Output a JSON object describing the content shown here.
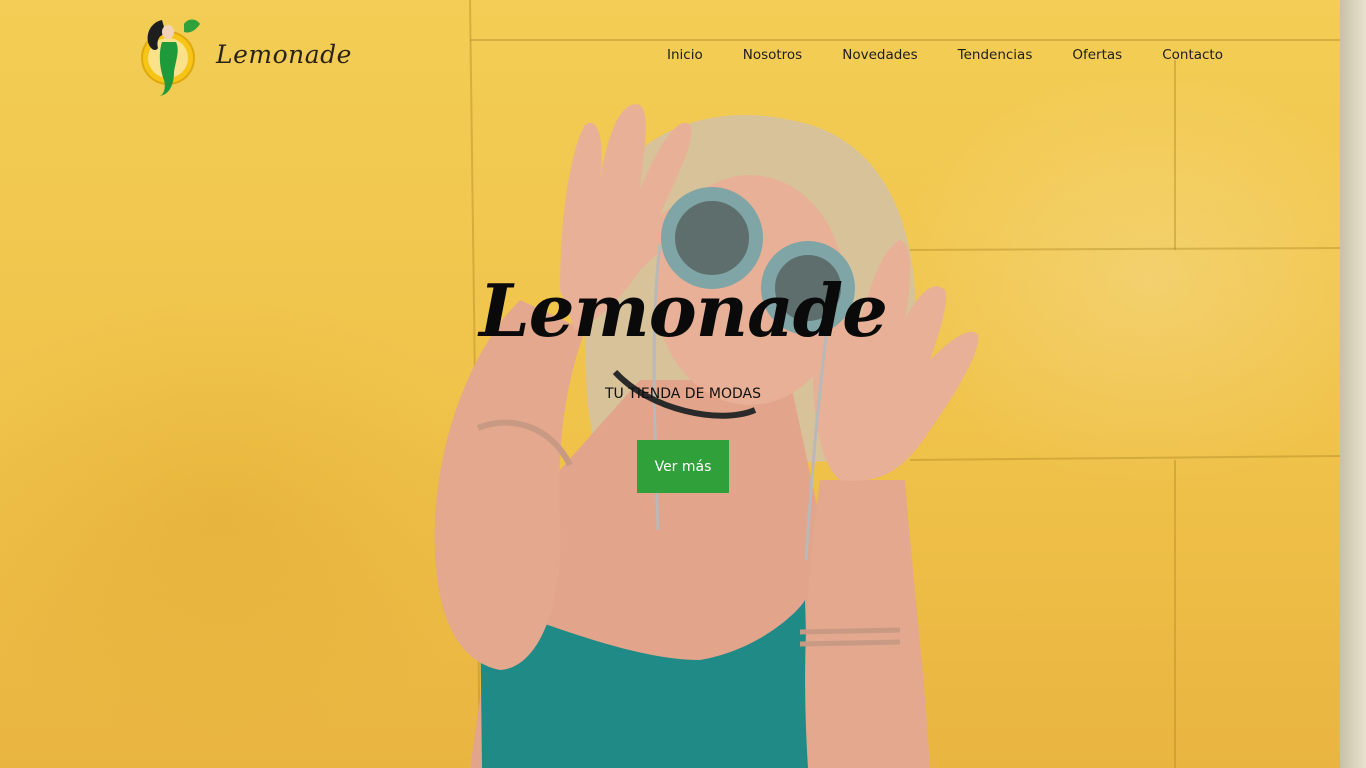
{
  "brand": {
    "name": "Lemonade",
    "accent": "#2fa03a"
  },
  "nav": {
    "items": [
      {
        "label": "Inicio"
      },
      {
        "label": "Nosotros"
      },
      {
        "label": "Novedades"
      },
      {
        "label": "Tendencias"
      },
      {
        "label": "Ofertas"
      },
      {
        "label": "Contacto"
      }
    ]
  },
  "hero": {
    "title": "Lemonade",
    "subtitle": "TU TIENDA DE MODAS",
    "button_label": "Ver más",
    "background_color": "#f0c34a"
  }
}
